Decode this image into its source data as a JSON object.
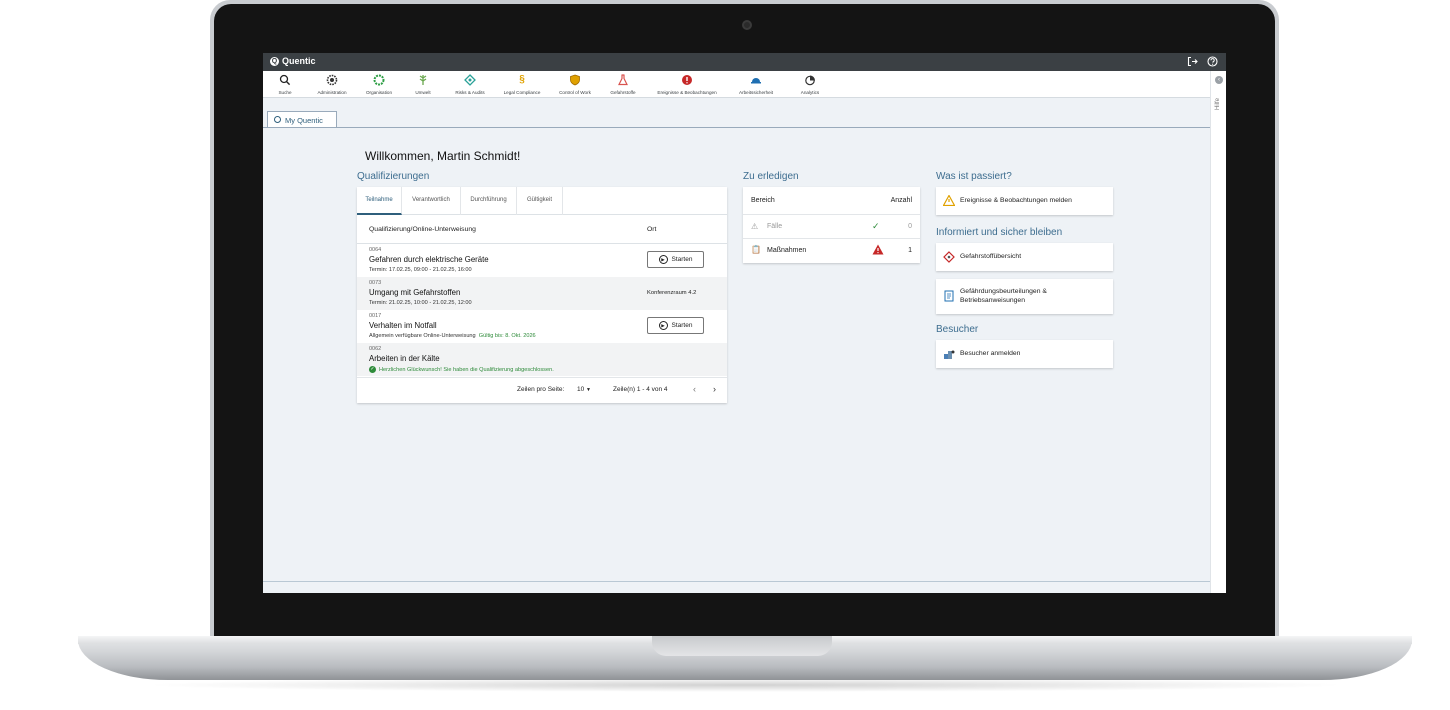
{
  "app": {
    "brand": "Quentic"
  },
  "toolbar": {
    "items": [
      {
        "label": "Suche",
        "icon": "search-icon"
      },
      {
        "label": "Administration",
        "icon": "gear-icon"
      },
      {
        "label": "Organisation",
        "icon": "organisation-icon"
      },
      {
        "label": "Umwelt",
        "icon": "leaf-icon"
      },
      {
        "label": "Risks & Audits",
        "icon": "risk-icon"
      },
      {
        "label": "Legal Compliance",
        "icon": "paragraph-icon"
      },
      {
        "label": "Control of Work",
        "icon": "shield-icon"
      },
      {
        "label": "Gefahrstoffe",
        "icon": "flask-icon"
      },
      {
        "label": "Ereignisse & Beobachtungen",
        "icon": "event-icon"
      },
      {
        "label": "Arbeitssicherheit",
        "icon": "helmet-icon"
      },
      {
        "label": "Analytics",
        "icon": "analytics-icon"
      }
    ]
  },
  "help": {
    "label": "Hilfe"
  },
  "tabs": [
    {
      "label": "My Quentic"
    }
  ],
  "welcome": "Willkommen, Martin Schmidt!",
  "qualifications": {
    "title": "Qualifizierungen",
    "tabs": [
      "Teilnahme",
      "Verantwortlich",
      "Durchführung",
      "Gültigkeit"
    ],
    "columns": [
      "Qualifizierung/Online-Unterweisung",
      "Ort"
    ],
    "rows": [
      {
        "id": "0064",
        "title": "Gefahren durch elektrische Geräte",
        "sub": "Termin: 17.02.25, 09:00 - 21.02.25, 16:00",
        "action": "Starten"
      },
      {
        "id": "0073",
        "title": "Umgang mit Gefahrstoffen",
        "sub": "Termin: 21.02.25, 10:00 - 21.02.25, 12:00",
        "ort": "Konferenzraum 4.2"
      },
      {
        "id": "0017",
        "title": "Verhalten im Notfall",
        "sub": "Allgemein verfügbare Online-Unterweisung",
        "validity": "Gültig bis: 8. Okt. 2026",
        "action": "Starten"
      },
      {
        "id": "0062",
        "title": "Arbeiten in der Kälte",
        "done": "Herzlichen Glückwunsch! Sie haben die Qualifizierung abgeschlossen."
      }
    ],
    "pager": {
      "rows_label": "Zeilen pro Seite:",
      "rows_value": "10",
      "range": "Zeile(n) 1 - 4 von 4"
    }
  },
  "todo": {
    "title": "Zu erledigen",
    "col_area": "Bereich",
    "col_count": "Anzahl",
    "rows": [
      {
        "label": "Fälle",
        "count": "0",
        "status": "ok"
      },
      {
        "label": "Maßnahmen",
        "count": "1",
        "status": "warning"
      }
    ]
  },
  "what_happened": {
    "title": "Was ist passiert?",
    "items": [
      {
        "label": "Ereignisse & Beobachtungen melden",
        "icon": "warning-icon"
      }
    ]
  },
  "informed": {
    "title": "Informiert und sicher bleiben",
    "items": [
      {
        "label": "Gefahrstoffübersicht",
        "icon": "hazard-icon"
      },
      {
        "label_1": "Gefährdungsbeurteilungen &",
        "label_2": "Betriebsanweisungen",
        "icon": "document-icon"
      }
    ]
  },
  "visitors": {
    "title": "Besucher",
    "items": [
      {
        "label": "Besucher anmelden",
        "icon": "visitor-icon"
      }
    ]
  },
  "colors": {
    "topbar": "#3b4044",
    "accent": "#3d6d8f",
    "success": "#2e8b3a",
    "danger": "#c62828",
    "warning": "#e0a100"
  }
}
